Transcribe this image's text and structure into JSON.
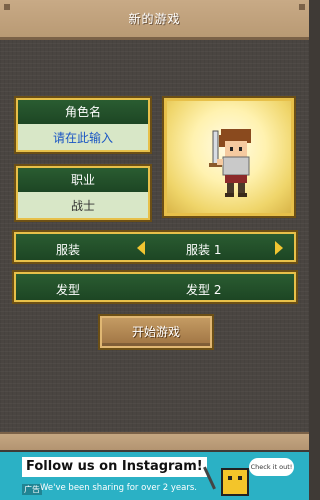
{
  "header": {
    "title": "新的游戏"
  },
  "name_field": {
    "label": "角色名",
    "value": "请在此输入"
  },
  "job_field": {
    "label": "职业",
    "value": "战士"
  },
  "outfit_row": {
    "label": "服装",
    "value": "服装 1"
  },
  "hair_row": {
    "label": "发型",
    "value": "发型 2"
  },
  "start_button": {
    "label": "开始游戏"
  },
  "ad": {
    "headline": "Follow us on Instagram!",
    "subtext": "We've been sharing for over 2 years.",
    "tag": "广告",
    "cta": "Check it out!"
  },
  "colors": {
    "accent_gold": "#e7c04a",
    "panel_green": "#1d4624",
    "input_bg": "#d8e7c7",
    "placeholder_blue": "#1a56c4",
    "ad_bg": "#2bb1c5"
  }
}
